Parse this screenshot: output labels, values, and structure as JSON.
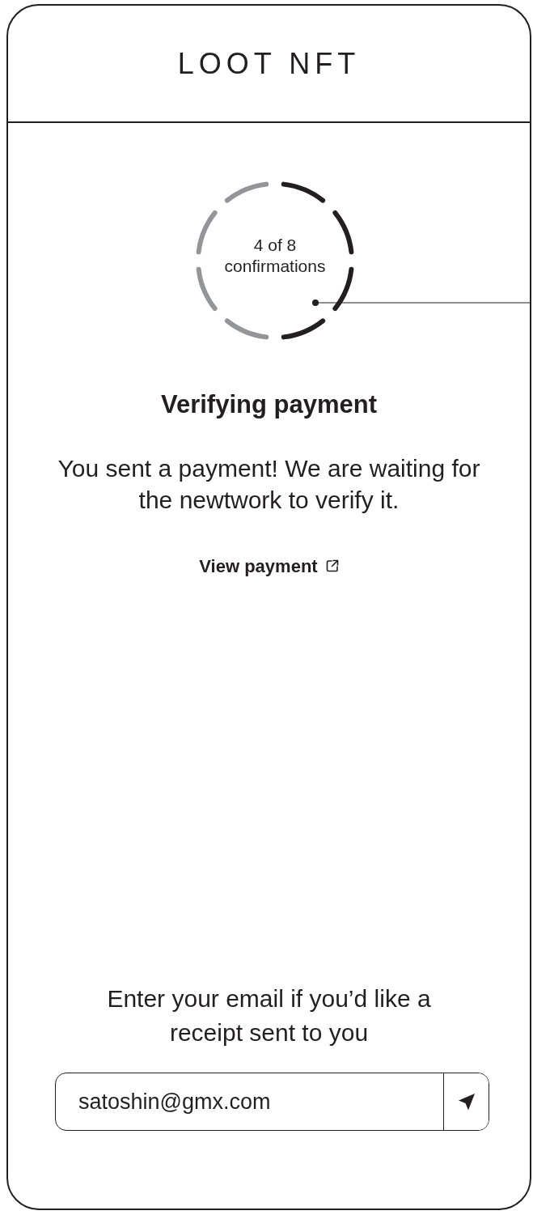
{
  "logo": {
    "text": "LOOT NFT"
  },
  "progress": {
    "count": "4 of 8",
    "label": "confirmations",
    "segments": [
      {
        "confirmed": true
      },
      {
        "confirmed": true
      },
      {
        "confirmed": true
      },
      {
        "confirmed": true
      },
      {
        "confirmed": false
      },
      {
        "confirmed": false
      },
      {
        "confirmed": false
      },
      {
        "confirmed": false
      }
    ]
  },
  "title": "Verifying payment",
  "message": "You sent a payment! We are waiting for the newtwork to verify it.",
  "link": {
    "label": "View payment"
  },
  "receipt": {
    "prompt": "Enter your email if you’d like a receipt sent to you",
    "email": "satoshin@gmx.com"
  }
}
